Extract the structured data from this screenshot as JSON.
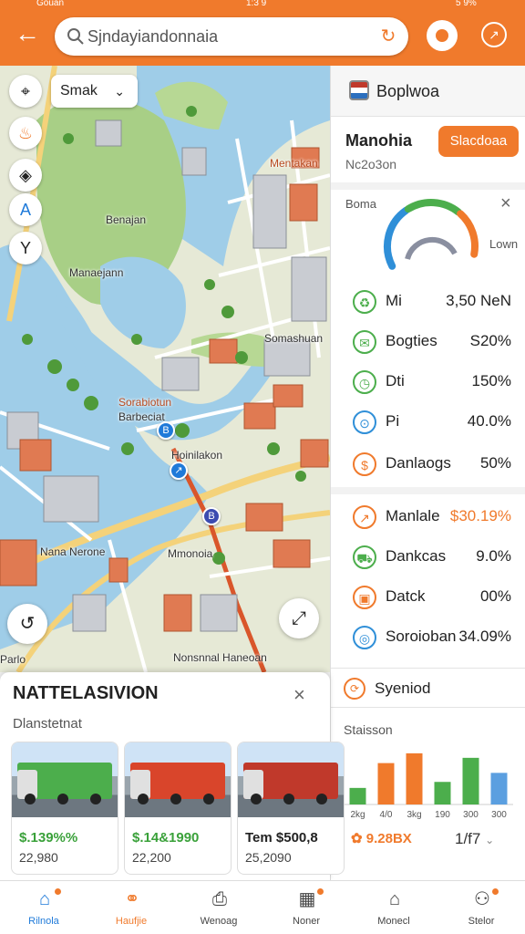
{
  "status_bar": {
    "left": "Gouan",
    "center": "1:3 9",
    "right": "5 9%"
  },
  "search": {
    "value": "Sjndayiandonnaia",
    "icon": "search-icon"
  },
  "map": {
    "filter": {
      "label": "Smak",
      "icon": "chevron-down-icon"
    },
    "tools": [
      "navigation-icon",
      "fire-icon",
      "layers-icon",
      "route-icon",
      "direction-icon"
    ],
    "labels": [
      "Mentakan",
      "Benajan",
      "Manaejann",
      "Somashuan",
      "Sorabiotun",
      "Barbeciat",
      "Hoinilakon",
      "Nana Nerone",
      "Mmonoia",
      "Nonsnnal Haneoan",
      "Parlo"
    ]
  },
  "panel": {
    "header": "Boplwoa",
    "section_title": "Manohia",
    "section_sub": "Nc2o3on",
    "action_button": "Slacdoaa",
    "gauge_left": "Boma",
    "gauge_right": "Lown",
    "gauge": {
      "segments": [
        0.35,
        0.3,
        0.25
      ],
      "colors": [
        "#2f8fd8",
        "#4cae4c",
        "#f07a2c"
      ]
    },
    "stats": [
      {
        "icon": "recycle-icon",
        "label": "Mi",
        "value": "3,50 NeN",
        "color": "#4cae4c"
      },
      {
        "icon": "chat-icon",
        "label": "Bogties",
        "value": "S20%",
        "color": "#4cae4c"
      },
      {
        "icon": "timer-icon",
        "label": "Dti",
        "value": "150%",
        "color": "#4cae4c"
      },
      {
        "icon": "pin-icon",
        "label": "Pi",
        "value": "40.0%",
        "color": "#2f8fd8"
      },
      {
        "icon": "coin-icon",
        "label": "Danlaogs",
        "value": "50%",
        "color": "#f07a2c"
      },
      {
        "icon": "trend-icon",
        "label": "Manlale",
        "value": "$30.19%",
        "color": "#f07a2c",
        "highlight": true
      },
      {
        "icon": "truck-icon",
        "label": "Dankcas",
        "value": "9.0%",
        "color": "#4cae4c"
      },
      {
        "icon": "package-icon",
        "label": "Datck",
        "value": "00%",
        "color": "#f07a2c"
      },
      {
        "icon": "target-icon",
        "label": "Soroioban",
        "value": "34.09%",
        "color": "#2f8fd8"
      }
    ],
    "sync_label": "Syeniod",
    "chart_title": "Staisson",
    "footer_left": "9.28BX",
    "footer_right": "1/f7"
  },
  "chart_data": {
    "type": "bar",
    "categories": [
      "2kg",
      "4/0",
      "3kg",
      "190",
      "300",
      "300"
    ],
    "values": [
      22,
      55,
      68,
      30,
      62,
      42
    ],
    "colors": [
      "#4cae4c",
      "#f07a2c",
      "#f07a2c",
      "#4cae4c",
      "#4cae4c",
      "#5b9fe0"
    ],
    "ylim": [
      0,
      80
    ]
  },
  "sheet": {
    "title": "NATTELASIVION",
    "subtitle": "Dlanstetnat",
    "cards": [
      {
        "price": "$.139%%",
        "qty": "22,980",
        "price_color": "#3aa13a",
        "truck_color": "#4cae4c"
      },
      {
        "price": "$.14&1990",
        "qty": "22,200",
        "price_color": "#3aa13a",
        "truck_color": "#d9452b"
      },
      {
        "price": "Tem $500,8",
        "qty": "25,2090",
        "price_color": "#222",
        "truck_color": "#c0392b"
      }
    ]
  },
  "nav": [
    {
      "label": "Rilnola",
      "icon": "home-icon",
      "active": true,
      "dot": true
    },
    {
      "label": "Haufjie",
      "icon": "link-icon",
      "active": false,
      "dot": false,
      "orange": true
    },
    {
      "label": "Wenoag",
      "icon": "printer-icon",
      "active": false,
      "dot": false
    },
    {
      "label": "Noner",
      "icon": "chart-icon",
      "active": false,
      "dot": true
    },
    {
      "label": "Monecl",
      "icon": "house-icon",
      "active": false,
      "dot": false
    },
    {
      "label": "Stelor",
      "icon": "user-icon",
      "active": false,
      "dot": true
    }
  ]
}
